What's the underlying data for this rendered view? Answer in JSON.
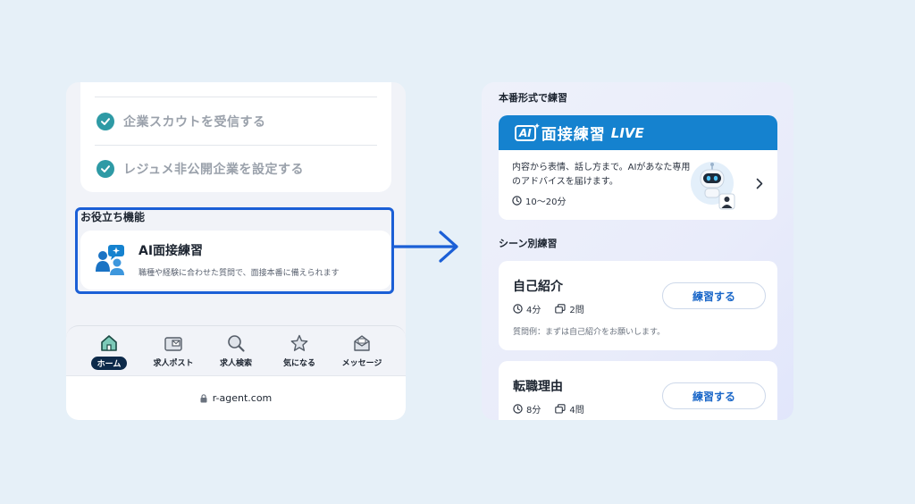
{
  "left_phone": {
    "checklist": [
      {
        "label": "企業スカウトを受信する"
      },
      {
        "label": "レジュメ非公開企業を設定する"
      }
    ],
    "section_title": "お役立ち機能",
    "ai_card": {
      "title": "AI面接練習",
      "description": "職種や経験に合わせた質問で、面接本番に備えられます"
    },
    "tabs": [
      {
        "label": "ホーム",
        "icon": "home-icon",
        "active": true
      },
      {
        "label": "求人ポスト",
        "icon": "mailbox-icon"
      },
      {
        "label": "求人検索",
        "icon": "search-icon"
      },
      {
        "label": "気になる",
        "icon": "star-icon"
      },
      {
        "label": "メッセージ",
        "icon": "message-icon"
      }
    ],
    "url": "r-agent.com"
  },
  "right_panel": {
    "section_live": "本番形式で練習",
    "live_card": {
      "badge": "AI",
      "title": "面接練習",
      "subtitle": "LIVE",
      "description": "内容から表情、話し方まで。AIがあなた専用のアドバイスを届けます。",
      "time": "10〜20分"
    },
    "section_scene": "シーン別練習",
    "scenes": [
      {
        "title": "自己紹介",
        "duration": "4分",
        "questions": "2問",
        "example": "質問例：まずは自己紹介をお願いします。",
        "button": "練習する"
      },
      {
        "title": "転職理由",
        "duration": "8分",
        "questions": "4問",
        "button": "練習する"
      }
    ]
  },
  "colors": {
    "accent_blue": "#1582cf",
    "highlight": "#1b5fd6",
    "check_teal": "#2e9aa5",
    "nav_active": "#0d2a4a"
  }
}
